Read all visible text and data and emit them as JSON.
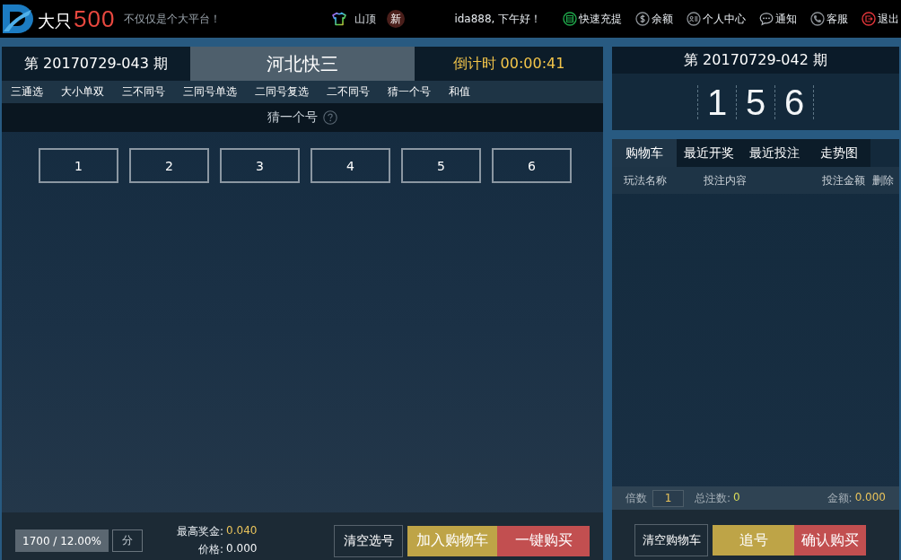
{
  "header": {
    "logo": {
      "main": "大只",
      "accent": "500"
    },
    "slogan": "不仅仅是个大平台！",
    "rank": "山顶",
    "badge": "新",
    "greeting": "ida888, 下午好！",
    "links": [
      {
        "label": "快速充提"
      },
      {
        "label": "余额"
      },
      {
        "label": "个人中心"
      },
      {
        "label": "通知"
      },
      {
        "label": "客服"
      },
      {
        "label": "退出"
      }
    ]
  },
  "game": {
    "period": "第 20170729-043 期",
    "title": "河北快三",
    "countdown": "倒计时 00:00:41",
    "tabs": [
      "三通选",
      "大小单双",
      "三不同号",
      "三同号单选",
      "二同号复选",
      "二不同号",
      "猜一个号",
      "和值"
    ],
    "play_title": "猜一个号",
    "numbers": [
      "1",
      "2",
      "3",
      "4",
      "5",
      "6"
    ],
    "odds": "1700 / 12.00%",
    "unit": "分",
    "max_prize_label": "最高奖金:",
    "max_prize": "0.040",
    "price_label": "价格:",
    "price": "0.000",
    "buttons": [
      {
        "label": "清空选号",
        "kind": "outline"
      },
      {
        "label": "加入购物车",
        "kind": "accent"
      },
      {
        "label": "一键购买",
        "kind": "danger"
      }
    ]
  },
  "draw": {
    "period": "第 20170729-042 期",
    "numbers": [
      "1",
      "5",
      "6"
    ]
  },
  "cart": {
    "tabs": [
      {
        "label": "购物车",
        "selected": true
      },
      {
        "label": "最近开奖",
        "selected": false
      },
      {
        "label": "最近投注",
        "selected": false
      },
      {
        "label": "走势图",
        "selected": false
      }
    ],
    "columns": [
      "玩法名称",
      "投注内容",
      "投注金额",
      "删除"
    ],
    "multiplier_label": "倍数",
    "multiplier": "1",
    "count_label": "总注数:",
    "count": "0",
    "amount_label": "金额:",
    "amount": "0.000",
    "buttons": [
      {
        "label": "清空购物车",
        "kind": "outline"
      },
      {
        "label": "追号",
        "kind": "accent"
      },
      {
        "label": "确认购买",
        "kind": "danger"
      }
    ]
  }
}
